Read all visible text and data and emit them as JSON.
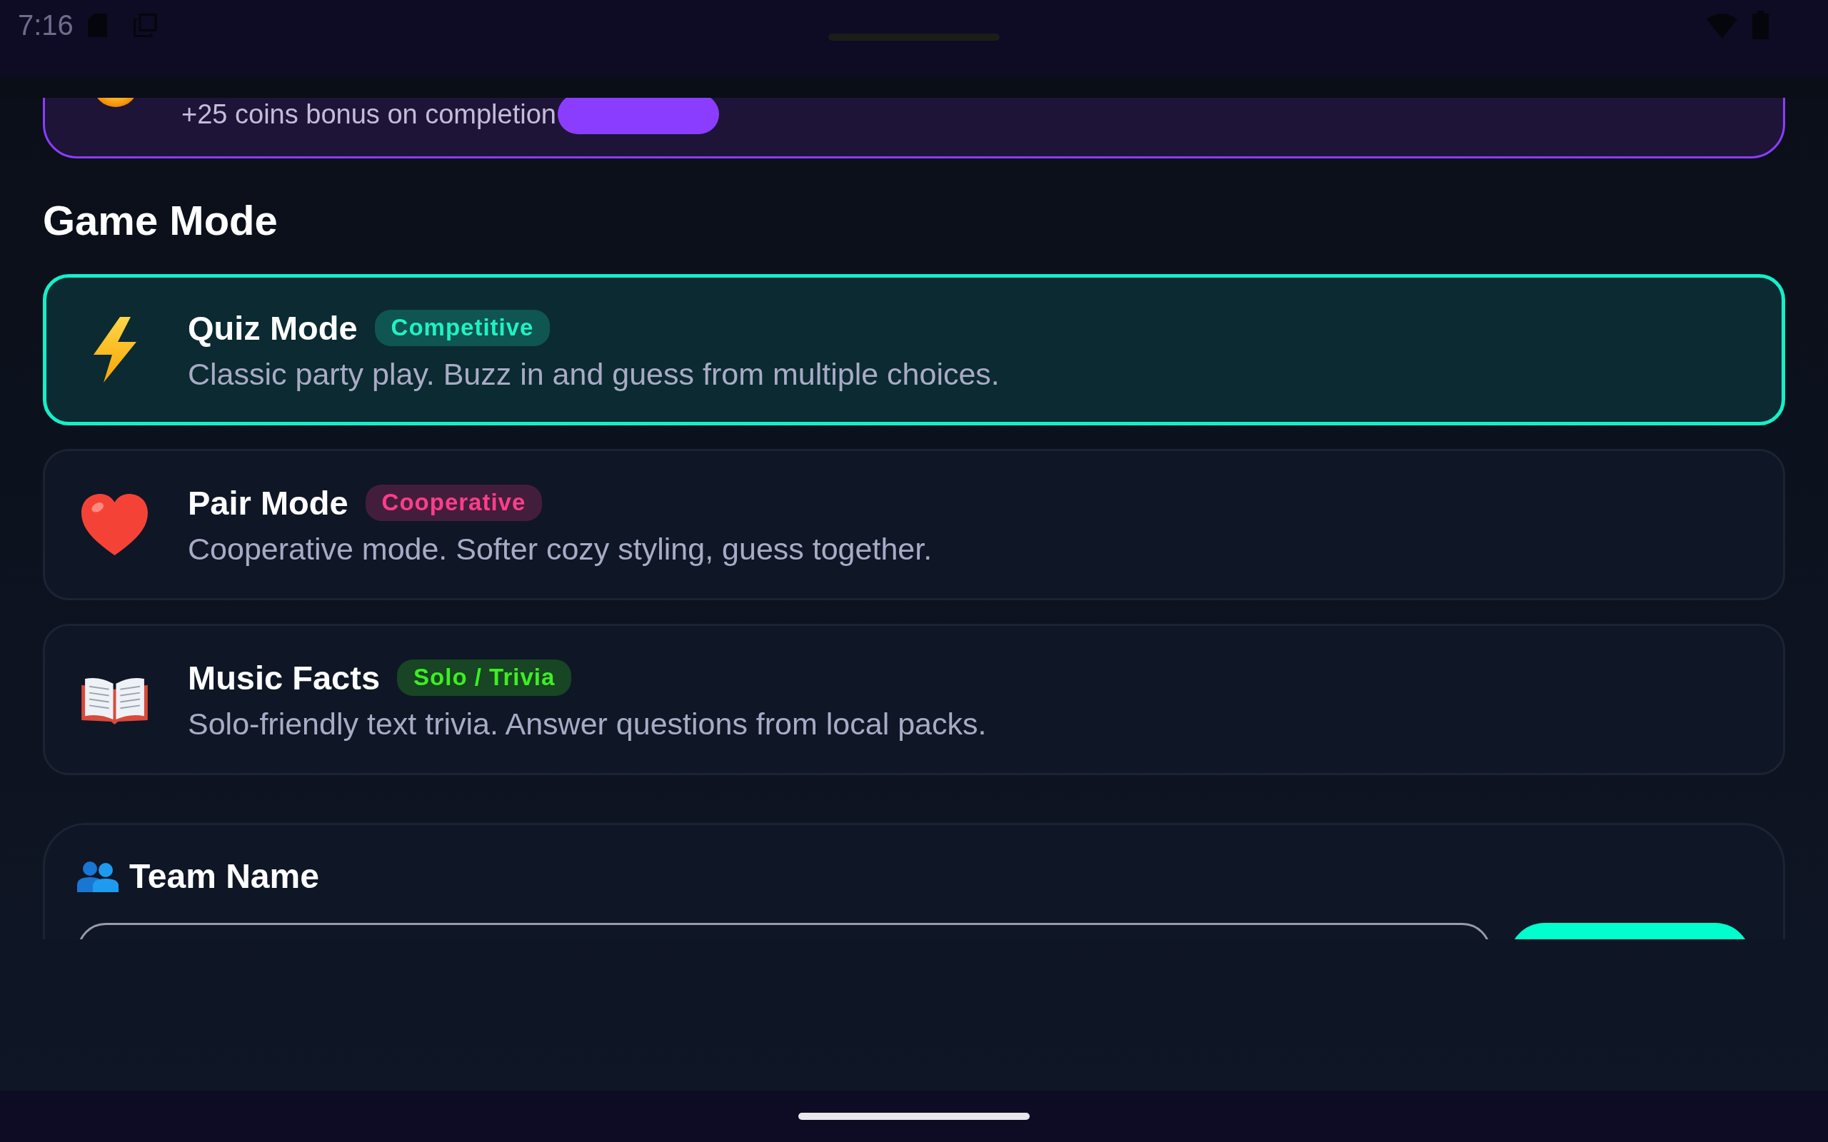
{
  "status_bar": {
    "time": "7:16"
  },
  "bonus_card": {
    "text": "+25 coins bonus on completion"
  },
  "game_mode": {
    "title": "Game Mode",
    "modes": [
      {
        "kind": "bolt",
        "name": "Quiz Mode",
        "tag": "Competitive",
        "color": "#1ff2c4",
        "description": "Classic party play. Buzz in and guess from multiple choices.",
        "selected": true
      },
      {
        "kind": "heart",
        "name": "Pair Mode",
        "tag": "Cooperative",
        "color": "#ff3d8b",
        "description": "Cooperative mode. Softer cozy styling, guess together.",
        "selected": false
      },
      {
        "kind": "book",
        "name": "Music Facts",
        "tag": "Solo / Trivia",
        "color": "#3cef22",
        "description": "Solo-friendly text trivia. Answer questions from local packs.",
        "selected": false
      }
    ]
  },
  "team": {
    "title": "Team Name"
  }
}
